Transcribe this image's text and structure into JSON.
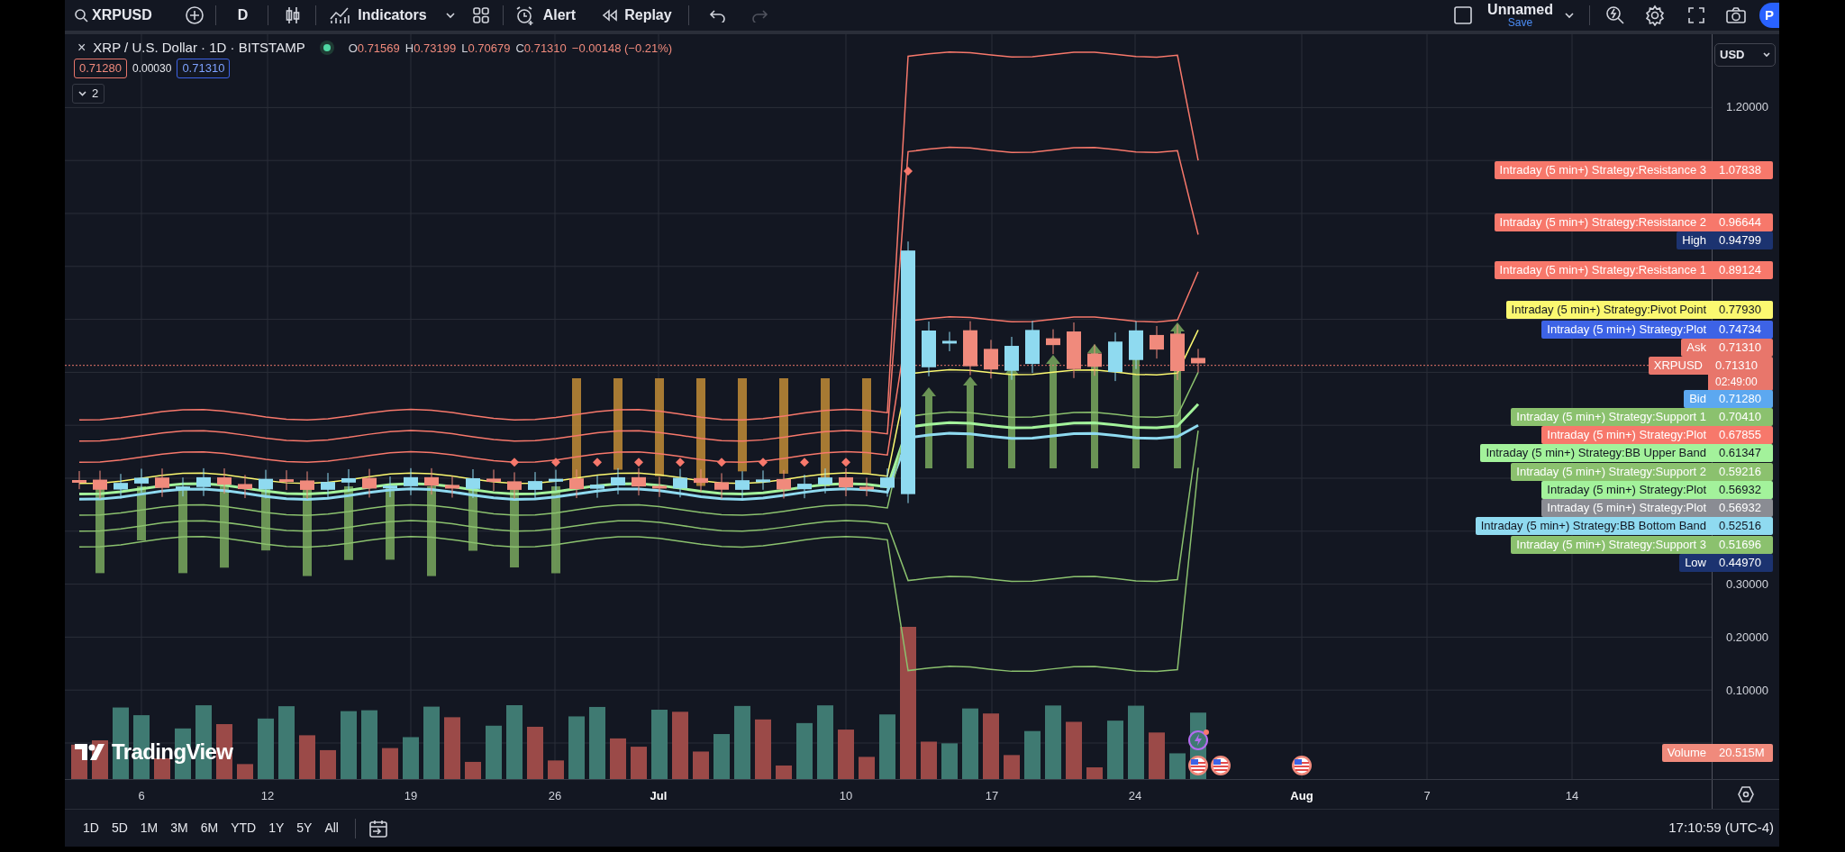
{
  "toolbar": {
    "symbol": "XRPUSD",
    "interval": "D",
    "indicators_label": "Indicators",
    "alert_label": "Alert",
    "replay_label": "Replay",
    "layout_name": "Unnamed",
    "save_label": "Save",
    "publish_label": "P"
  },
  "legend": {
    "close_glyph": "×",
    "title": "XRP / U.S. Dollar · 1D · BITSTAMP",
    "ohlc": [
      {
        "key": "O",
        "value": "0.71569"
      },
      {
        "key": "H",
        "value": "0.73199"
      },
      {
        "key": "L",
        "value": "0.70679"
      },
      {
        "key": "C",
        "value": "0.71310"
      }
    ],
    "change": "−0.00148 (−0.21%)",
    "bid": "0.71280",
    "spread": "0.00030",
    "ask": "0.71310",
    "indicators_count": "2"
  },
  "currency": "USD",
  "price_ticks": [
    "1.20000",
    "0.30000",
    "0.20000",
    "0.10000"
  ],
  "price_labels": [
    {
      "name": "Intraday (5 min+) Strategy:Resistance 3",
      "value": "1.07838",
      "color": "#f7786b"
    },
    {
      "name": "Intraday (5 min+) Strategy:Resistance 2",
      "value": "0.96644",
      "color": "#f7786b"
    },
    {
      "name": "High",
      "value": "0.94799",
      "color": "#1c3370"
    },
    {
      "name": "Intraday (5 min+) Strategy:Resistance 1",
      "value": "0.89124",
      "color": "#f7786b"
    },
    {
      "name": "Intraday (5 min+) Strategy:Pivot Point",
      "value": "0.77930",
      "color": "#fbf870"
    },
    {
      "name": "Intraday (5 min+) Strategy:Plot",
      "value": "0.74734",
      "color": "#3d63e6"
    },
    {
      "name": "Ask",
      "value": "0.71310",
      "color": "#e8766b"
    },
    {
      "name": "XRPUSD",
      "value": "0.71310",
      "countdown": "02:49:00",
      "color": "#e8766b"
    },
    {
      "name": "Bid",
      "value": "0.71280",
      "color": "#5ca8f0"
    },
    {
      "name": "Intraday (5 min+) Strategy:Support 1",
      "value": "0.70410",
      "color": "#8bc16e"
    },
    {
      "name": "Intraday (5 min+) Strategy:Plot",
      "value": "0.67855",
      "color": "#f7786b"
    },
    {
      "name": "Intraday (5 min+) Strategy:BB Upper Band",
      "value": "0.61347",
      "color": "#a3f29b"
    },
    {
      "name": "Intraday (5 min+) Strategy:Support 2",
      "value": "0.59216",
      "color": "#8bc16e"
    },
    {
      "name": "Intraday (5 min+) Strategy:Plot",
      "value": "0.56932",
      "color": "#a3f29b"
    },
    {
      "name": "Intraday (5 min+) Strategy:Plot",
      "value": "0.56932",
      "color": "#8a8c93"
    },
    {
      "name": "Intraday (5 min+) Strategy:BB Bottom Band",
      "value": "0.52516",
      "color": "#8fdaf0"
    },
    {
      "name": "Intraday (5 min+) Strategy:Support 3",
      "value": "0.51696",
      "color": "#8bc16e"
    },
    {
      "name": "Low",
      "value": "0.44970",
      "color": "#1c3370"
    }
  ],
  "volume_label": {
    "name": "Volume",
    "value": "20.515M",
    "color": "#f08a7c"
  },
  "branding": "TradingView",
  "time_ticks": [
    {
      "label": "6",
      "kind": "day"
    },
    {
      "label": "12",
      "kind": "day"
    },
    {
      "label": "19",
      "kind": "day"
    },
    {
      "label": "26",
      "kind": "day"
    },
    {
      "label": "Jul",
      "kind": "month"
    },
    {
      "label": "10",
      "kind": "day"
    },
    {
      "label": "17",
      "kind": "day"
    },
    {
      "label": "24",
      "kind": "day"
    },
    {
      "label": "Aug",
      "kind": "month"
    },
    {
      "label": "7",
      "kind": "day"
    },
    {
      "label": "14",
      "kind": "day"
    }
  ],
  "ranges": [
    "1D",
    "5D",
    "1M",
    "3M",
    "6M",
    "YTD",
    "1Y",
    "5Y",
    "All"
  ],
  "clock": "17:10:59 (UTC-4)"
}
